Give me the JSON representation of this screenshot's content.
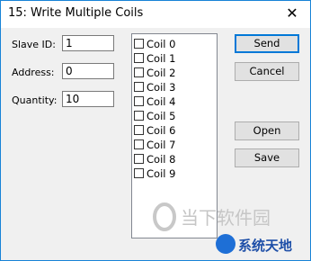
{
  "window": {
    "title": "15: Write Multiple Coils",
    "close_glyph": "✕"
  },
  "fields": {
    "slave_id": {
      "label": "Slave ID:",
      "value": "1"
    },
    "address": {
      "label": "Address:",
      "value": "0"
    },
    "quantity": {
      "label": "Quantity:",
      "value": "10"
    }
  },
  "coils": [
    "Coil 0",
    "Coil 1",
    "Coil 2",
    "Coil 3",
    "Coil 4",
    "Coil 5",
    "Coil 6",
    "Coil 7",
    "Coil 8",
    "Coil 9"
  ],
  "buttons": {
    "send": "Send",
    "cancel": "Cancel",
    "open": "Open",
    "save": "Save"
  },
  "watermark": {
    "text1": "当下软件园",
    "text2": "系统天地"
  }
}
